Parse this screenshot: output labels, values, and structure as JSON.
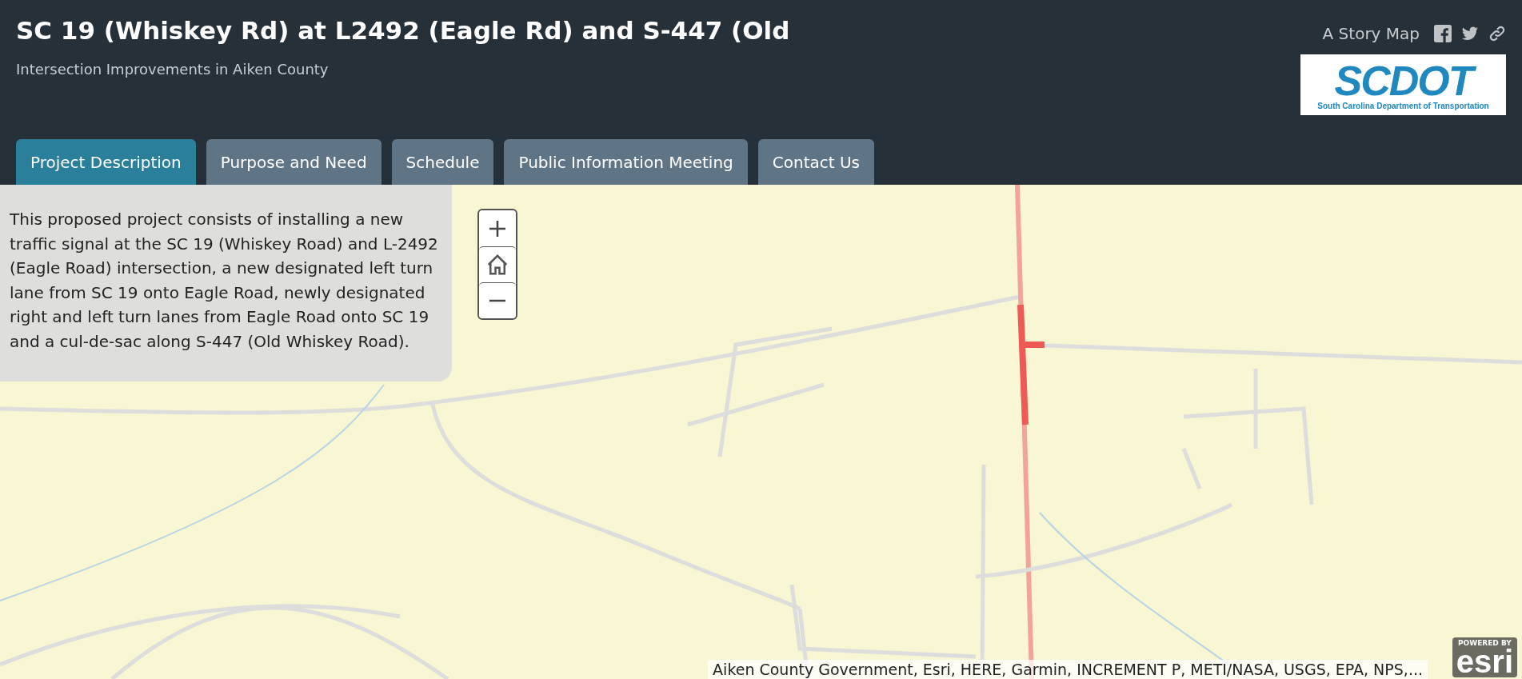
{
  "header": {
    "title": "SC 19 (Whiskey Rd) at L2492 (Eagle Rd) and S-447 (Old",
    "subtitle": "Intersection Improvements in Aiken County",
    "story_map_label": "A Story Map",
    "logo": {
      "mark": "SCDOT",
      "caption": "South Carolina Department of Transportation"
    }
  },
  "tabs": [
    {
      "label": "Project Description",
      "selected": true
    },
    {
      "label": "Purpose and Need",
      "selected": false
    },
    {
      "label": "Schedule",
      "selected": false
    },
    {
      "label": "Public Information Meeting",
      "selected": false
    },
    {
      "label": "Contact Us",
      "selected": false
    }
  ],
  "description": "This proposed project consists of installing a new traffic signal at the SC 19 (Whiskey Road) and L-2492 (Eagle Road) intersection, a new designated left turn lane from SC 19 onto Eagle Road, newly designated right and left turn lanes from Eagle Road onto SC 19 and a cul-de-sac along S-447 (Old Whiskey Road).",
  "map": {
    "kind": "picture",
    "attribution": "Aiken County Government, Esri, HERE, Garmin, INCREMENT P, METI/NASA, USGS, EPA, NPS,...",
    "powered_by": "POWERED BY",
    "powered_brand": "esri"
  }
}
